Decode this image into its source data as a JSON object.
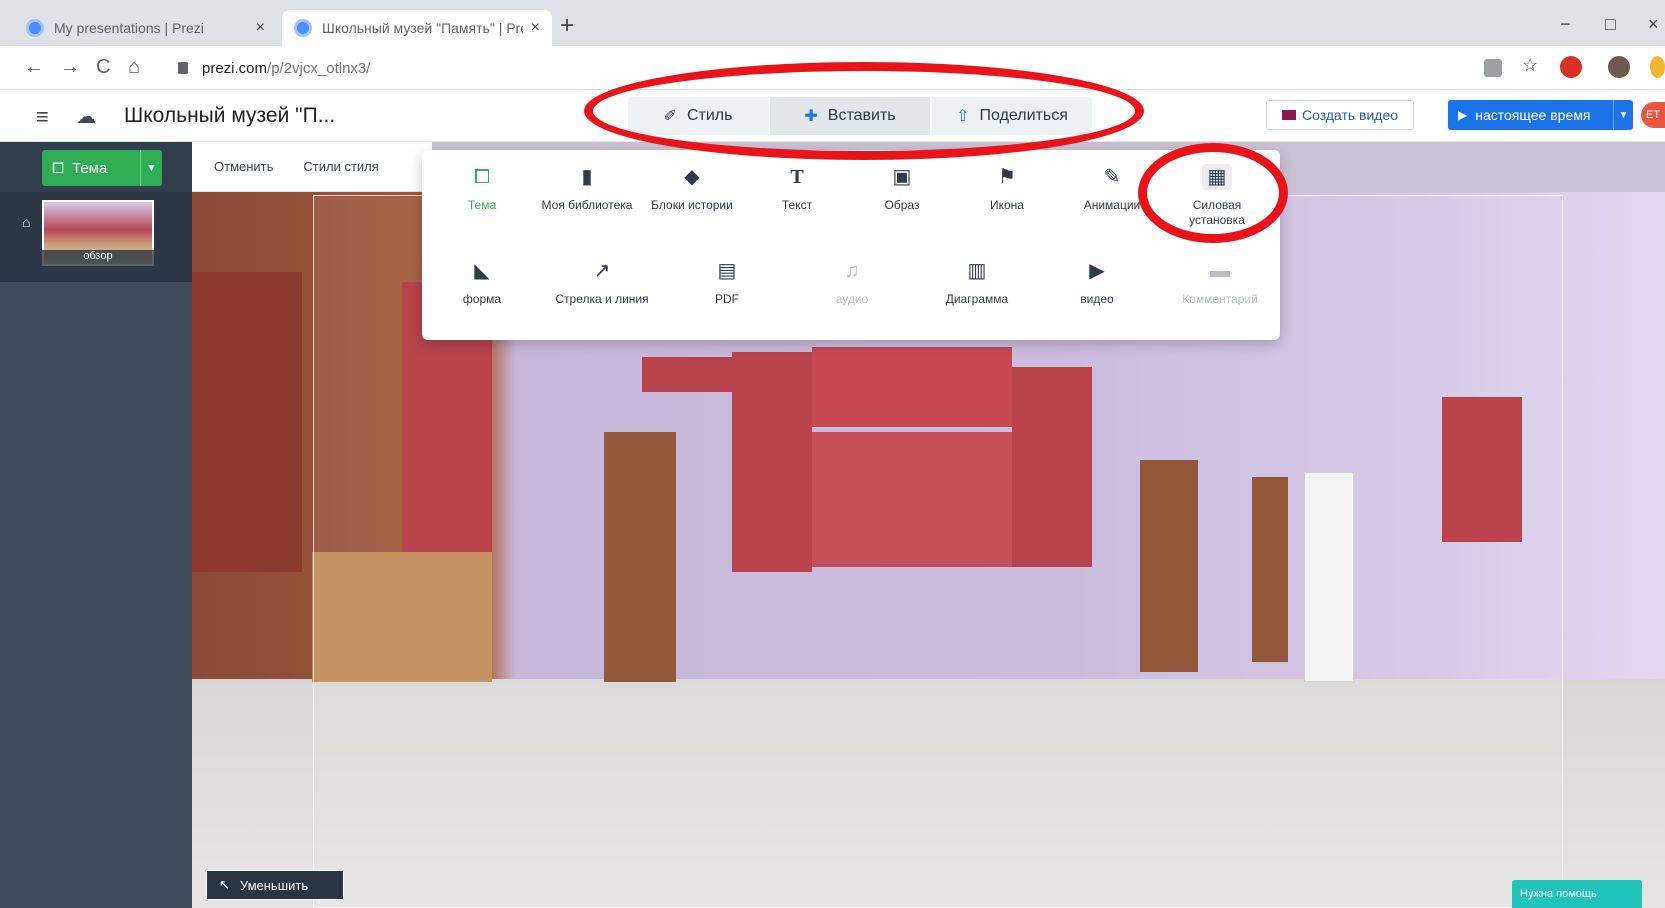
{
  "browser": {
    "tabs": [
      {
        "title": "My presentations | Prezi",
        "close": "×"
      },
      {
        "title": "Школьный музей \"Память\" | Pre",
        "close": "×"
      }
    ],
    "new_tab": "+",
    "window_controls": {
      "minimize": "−",
      "maximize": "□",
      "close": "×"
    },
    "address": {
      "domain": "prezi.com",
      "path": "/p/2vjcx_otlnx3/"
    },
    "nav": {
      "back": "←",
      "forward": "→",
      "reload": "C",
      "home": "⌂"
    }
  },
  "prezi": {
    "menu_icon": "≡",
    "title": "Школьный музей \"П...",
    "segments": {
      "style": {
        "icon": "✐",
        "label": "Стиль"
      },
      "insert": {
        "icon": "✚",
        "label": "Вставить"
      },
      "share": {
        "icon": "⇧",
        "label": "Поделиться"
      }
    },
    "create_video": "Создать видео",
    "present": {
      "icon": "▶",
      "label": "настоящее время",
      "arrow": "▼"
    },
    "avatar_initials": "ET"
  },
  "sidebar": {
    "theme_button": {
      "label": "Тема",
      "icon": "⧠",
      "arrow": "▼"
    },
    "overview_label": "обзор"
  },
  "subtoolbar": {
    "undo": "Отменить",
    "styles": "Стили стиля"
  },
  "insert_menu": {
    "row1": [
      {
        "icon": "⧠",
        "label": "Тема"
      },
      {
        "icon": "▮",
        "label": "Моя библиотека"
      },
      {
        "icon": "◆",
        "label": "Блоки истории"
      },
      {
        "icon": "T",
        "label": "Текст"
      },
      {
        "icon": "▣",
        "label": "Образ"
      },
      {
        "icon": "⚑",
        "label": "Икона"
      },
      {
        "icon": "✎",
        "label": "Анимации"
      },
      {
        "icon": "▦",
        "label": "Силовая установка"
      }
    ],
    "row2": [
      {
        "icon": "◣",
        "label": "форма"
      },
      {
        "icon": "↗",
        "label": "Стрелка и линия"
      },
      {
        "icon": "▤",
        "label": "PDF"
      },
      {
        "icon": "♫",
        "label": "аудио"
      },
      {
        "icon": "▥",
        "label": "Диаграмма"
      },
      {
        "icon": "▶",
        "label": "видео"
      },
      {
        "icon": "▬",
        "label": "Комментарий"
      }
    ]
  },
  "canvas": {
    "zoom_out": {
      "icon": "↖",
      "label": "Уменьшить"
    },
    "help": "Нужна помощь"
  },
  "colors": {
    "annotation_red": "#e8141a",
    "prezi_green": "#2fae55",
    "present_blue": "#1a73e8",
    "sidebar": "#3e4a5a"
  }
}
